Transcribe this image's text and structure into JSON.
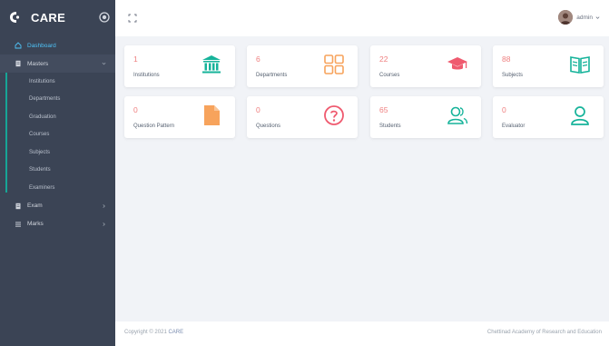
{
  "app": {
    "name": "CARE"
  },
  "sidebar": {
    "items": [
      {
        "label": "Dashboard",
        "icon": "home-icon"
      },
      {
        "label": "Masters",
        "icon": "document-icon"
      },
      {
        "label": "Exam",
        "icon": "document-icon"
      },
      {
        "label": "Marks",
        "icon": "list-icon"
      }
    ],
    "masters_sub": [
      "Institutions",
      "Departments",
      "Graduation",
      "Courses",
      "Subjects",
      "Students",
      "Examiners"
    ]
  },
  "topbar": {
    "user_name": "admin"
  },
  "cards": [
    {
      "value": "1",
      "label": "Institutions",
      "icon": "institution-icon",
      "color": "#16b39a"
    },
    {
      "value": "6",
      "label": "Departments",
      "icon": "grid-icon",
      "color": "#f7a35c"
    },
    {
      "value": "22",
      "label": "Courses",
      "icon": "graduation-cap-icon",
      "color": "#ef5a6f"
    },
    {
      "value": "88",
      "label": "Subjects",
      "icon": "book-icon",
      "color": "#16b39a"
    },
    {
      "value": "0",
      "label": "Question Pattern",
      "icon": "file-icon",
      "color": "#f7a35c"
    },
    {
      "value": "0",
      "label": "Questions",
      "icon": "question-icon",
      "color": "#ef5a6f"
    },
    {
      "value": "65",
      "label": "Students",
      "icon": "users-icon",
      "color": "#16b39a"
    },
    {
      "value": "0",
      "label": "Evaluator",
      "icon": "user-icon",
      "color": "#16b39a"
    }
  ],
  "footer": {
    "copyright_prefix": "Copyright © 2021",
    "copyright_brand": "CARE",
    "org": "Chettinad Academy of Research and Education"
  }
}
